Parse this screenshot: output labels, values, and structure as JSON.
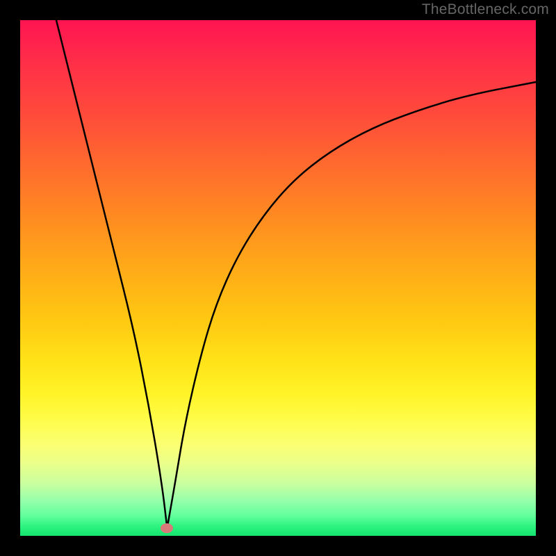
{
  "watermark": "TheBottleneck.com",
  "chart_data": {
    "type": "line",
    "title": "",
    "xlabel": "",
    "ylabel": "",
    "xlim": [
      0,
      100
    ],
    "ylim": [
      0,
      100
    ],
    "grid": false,
    "legend": false,
    "background": "rainbow-gradient",
    "marker": {
      "x": 28.5,
      "y": 1.5,
      "color": "#d97a7a"
    },
    "series": [
      {
        "name": "left-branch",
        "x": [
          7,
          10,
          14,
          18,
          22,
          25,
          27.5,
          28.5
        ],
        "y": [
          100,
          88,
          72,
          56,
          40,
          25,
          10,
          1.5
        ]
      },
      {
        "name": "right-branch",
        "x": [
          28.5,
          30,
          32,
          35,
          38,
          42,
          47,
          53,
          60,
          68,
          77,
          87,
          100
        ],
        "y": [
          1.5,
          10,
          22,
          35,
          45,
          54,
          62,
          69,
          74.5,
          79,
          82.5,
          85.5,
          88
        ]
      }
    ]
  }
}
